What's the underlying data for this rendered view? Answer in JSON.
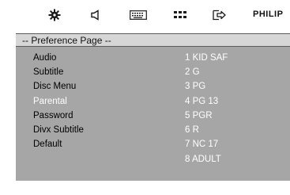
{
  "brand": "PHILIP",
  "icons": [
    "gear-icon",
    "speaker-icon",
    "keyboard-icon",
    "grid-icon",
    "exit-icon"
  ],
  "header": {
    "title": "-- Preference Page --"
  },
  "menu": {
    "items": [
      {
        "label": "Audio"
      },
      {
        "label": "Subtitle"
      },
      {
        "label": "Disc Menu"
      },
      {
        "label": "Parental"
      },
      {
        "label": "Password"
      },
      {
        "label": "Divx Subtitle"
      },
      {
        "label": "Default"
      }
    ],
    "active": "Parental"
  },
  "options": {
    "items": [
      {
        "label": "1 KID SAF"
      },
      {
        "label": "2 G"
      },
      {
        "label": "3 PG"
      },
      {
        "label": "4 PG 13"
      },
      {
        "label": "5 PGR"
      },
      {
        "label": "6 R"
      },
      {
        "label": "7 NC 17"
      },
      {
        "label": "8 ADULT"
      }
    ]
  },
  "colors": {
    "panel": "#a6a6a6",
    "header": "#d6d6d6",
    "highlight_text": "#ffffff"
  }
}
